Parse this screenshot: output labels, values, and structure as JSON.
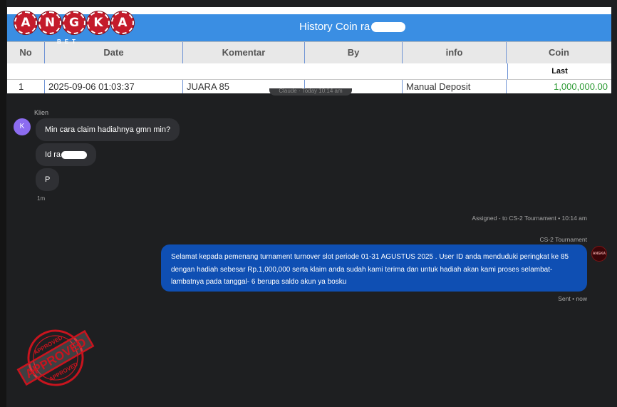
{
  "history": {
    "title": "History Coin ra",
    "columns": [
      "No",
      "Date",
      "Komentar",
      "By",
      "info",
      "Coin"
    ],
    "subheader_last": "Last",
    "rows": [
      {
        "no": "1",
        "date": "2025-09-06 01:03:37",
        "komentar": "JUARA 85",
        "by": "",
        "info": "Manual Deposit",
        "coin": "1,000,000.00"
      }
    ],
    "status_hint": "Claude · Today 10:14 am"
  },
  "logo": {
    "letters": [
      "A",
      "N",
      "G",
      "K",
      "A"
    ],
    "sub": "BET"
  },
  "chat": {
    "sender_label": "Klien",
    "avatar_initial": "K",
    "messages_in": [
      "Min cara claim hadiahnya gmn min?",
      "Id ra",
      "P"
    ],
    "time_in": "1m",
    "assigned_text": "Assigned - to CS-2 Tournament • 10:14 am",
    "agent_name": "CS-2 Tournament",
    "message_out": "Selamat kepada pemenang turnament turnover slot periode 01-31 AGUSTUS 2025 . User ID anda menduduki peringkat ke 85 dengan hadiah sebesar Rp.1,000,000 serta klaim anda sudah kami terima dan untuk hadiah akan kami proses selambat-lambatnya pada tanggal- 6 berupa saldo akun ya bosku",
    "agent_avatar_text": "ANGKA",
    "sent_status": "Sent • now"
  },
  "stamp": {
    "top_text": "APPROVED",
    "center_text": "APPROVED",
    "bottom_text": "APPROVED",
    "color": "#c8141e"
  },
  "colors": {
    "header_blue": "#3a8ee3",
    "out_bubble": "#0f4fb3",
    "coin_green": "#2e9b35",
    "avatar_purple": "#8c6cf0"
  }
}
